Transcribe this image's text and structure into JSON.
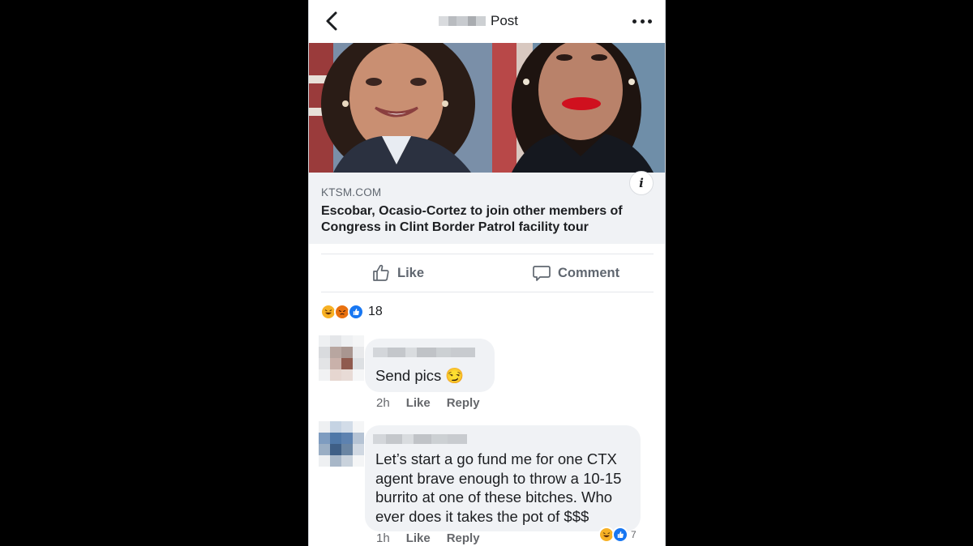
{
  "header": {
    "title": "Post",
    "back_icon": "chevron-left-icon",
    "more_icon": "ellipsis-icon"
  },
  "link_preview": {
    "domain": "KTSM.COM",
    "headline": "Escobar, Ocasio-Cortez to join other members of Congress in Clint Border Patrol facility tour",
    "info_icon": "i"
  },
  "actions": {
    "like_label": "Like",
    "comment_label": "Comment"
  },
  "reactions": {
    "icons": [
      "haha-icon",
      "angry-icon",
      "like-icon"
    ],
    "count": "18"
  },
  "comments": [
    {
      "text": "Send pics 😏",
      "time": "2h",
      "like_label": "Like",
      "reply_label": "Reply"
    },
    {
      "text": "Let’s start a go fund me for one CTX agent brave enough to throw a 10-15 burrito at one of these bitches. Who ever does it takes the pot of $$$",
      "time": "1h",
      "like_label": "Like",
      "reply_label": "Reply",
      "reaction_count": "7"
    }
  ],
  "colors": {
    "text_primary": "#1c1e21",
    "text_secondary": "#606770",
    "bubble_bg": "#f0f2f5",
    "like_blue": "#1877f2",
    "angry_orange": "#e9710f",
    "haha_yellow": "#f7b125"
  }
}
